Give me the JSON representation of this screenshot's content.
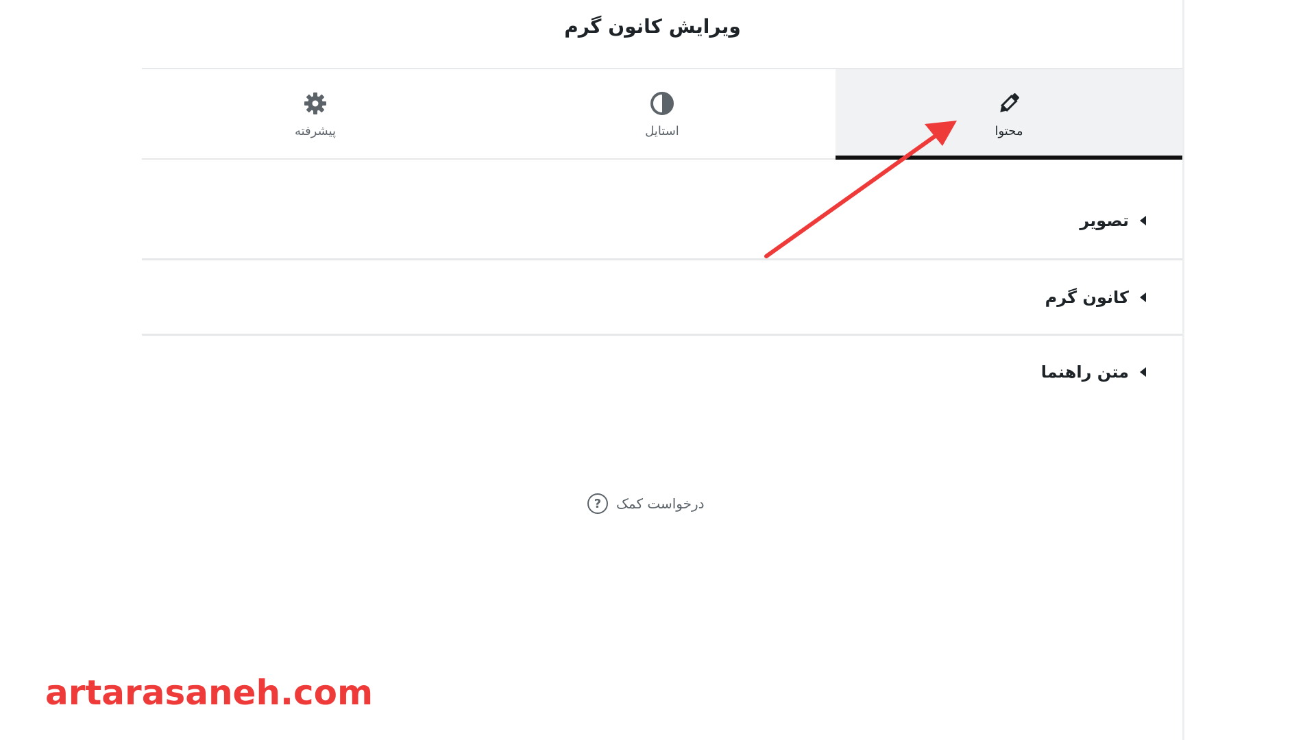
{
  "panel": {
    "title": "ویرایش کانون گرم"
  },
  "tabs": [
    {
      "label": "محتوا",
      "icon": "pencil-icon",
      "active": true
    },
    {
      "label": "استایل",
      "icon": "half-circle-style-icon",
      "active": false
    },
    {
      "label": "پیشرفته",
      "icon": "gear-icon",
      "active": false
    }
  ],
  "sections": [
    {
      "label": "تصویر",
      "icon": "caret-left-icon"
    },
    {
      "label": "کانون گرم",
      "icon": "caret-left-icon"
    },
    {
      "label": "متن راهنما",
      "icon": "caret-left-icon"
    }
  ],
  "help": {
    "label": "درخواست کمک",
    "icon": "question-circle-icon",
    "icon_glyph": "?"
  },
  "annotation": {
    "arrow_color": "#ef3a3a"
  },
  "watermark": {
    "text": "artarasaneh.com",
    "color": "#ef3a3a"
  },
  "colors": {
    "active_tab_bg": "#f1f2f3",
    "active_indicator": "#111111",
    "text_dark": "#1d2327",
    "text_muted": "#5c6369"
  }
}
